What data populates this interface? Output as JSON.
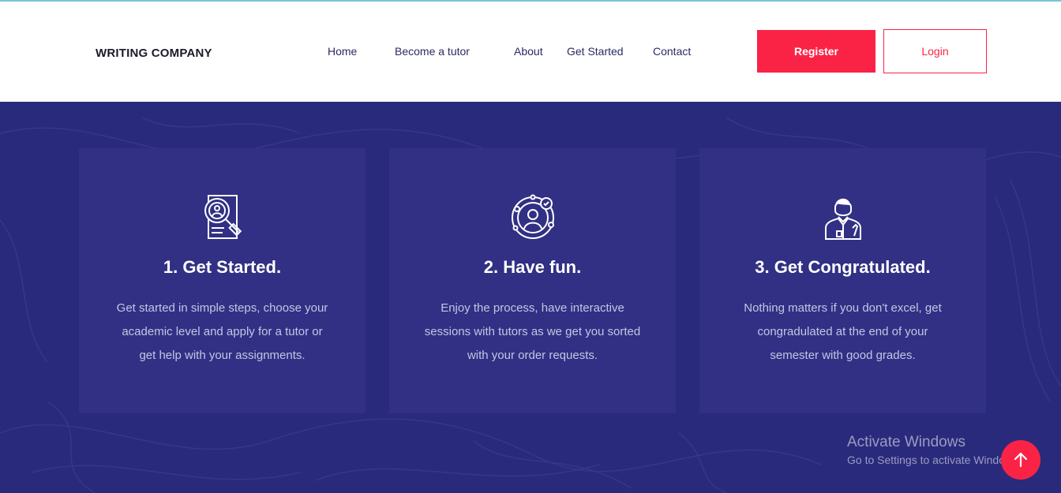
{
  "header": {
    "logo": "WRITING COMPANY",
    "nav": [
      "Home",
      "Become a tutor",
      "About",
      "Get Started",
      "Contact"
    ],
    "register_label": "Register",
    "login_label": "Login"
  },
  "steps": [
    {
      "icon": "resume-search-icon",
      "title": "1. Get Started.",
      "lines": [
        "Get started in simple steps, choose your",
        "academic level and apply for a tutor or",
        "get help with your assignments."
      ]
    },
    {
      "icon": "user-target-icon",
      "title": "2. Have fun.",
      "lines": [
        "Enjoy the process, have interactive",
        "sessions with tutors as we get you sorted",
        "with your order requests."
      ]
    },
    {
      "icon": "graduate-icon",
      "title": "3. Get Congratulated.",
      "lines": [
        "Nothing matters if you don't excel, get",
        "congradulated at the end of your",
        "semester with good grades."
      ]
    }
  ],
  "watermark": {
    "title": "Activate Windows",
    "subtitle": "Go to Settings to activate Windows."
  },
  "scroll_top_icon": "arrow-up-icon",
  "colors": {
    "accent": "#fb2345",
    "section_bg": "#2a2a7c",
    "card_bg": "#313084",
    "nav_text": "#2b2a63"
  }
}
